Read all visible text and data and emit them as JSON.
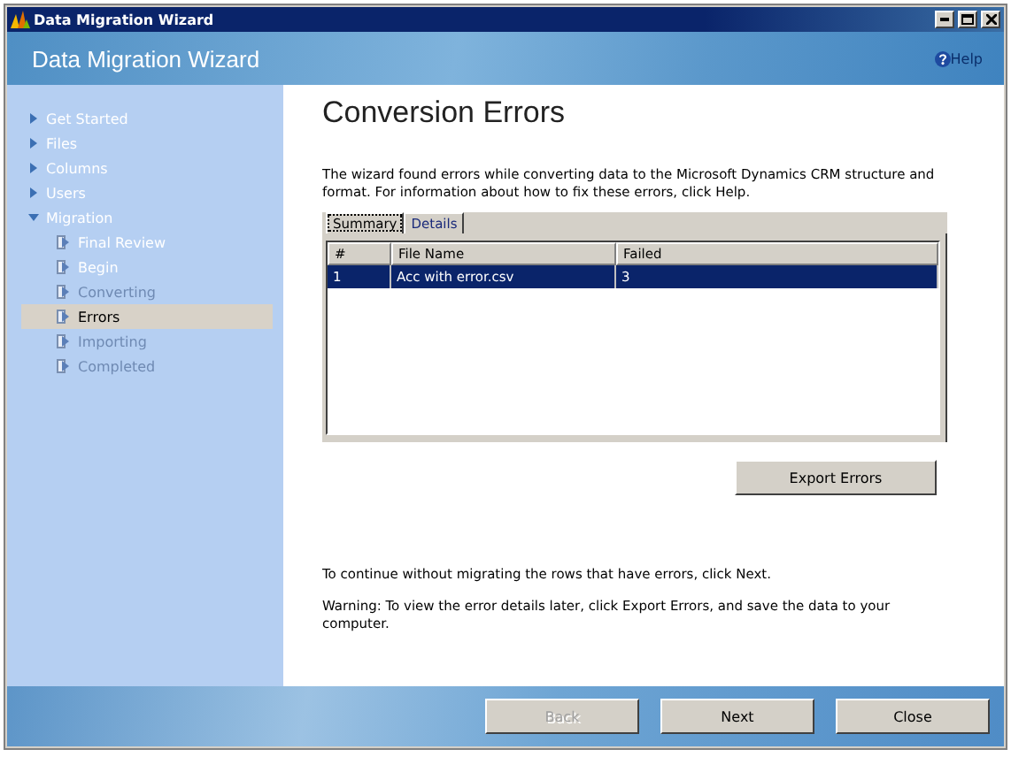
{
  "window": {
    "title": "Data Migration Wizard"
  },
  "header": {
    "title": "Data Migration Wizard",
    "help": "Help"
  },
  "sidebar": {
    "items": [
      {
        "label": "Get Started",
        "expanded": false,
        "selected": false,
        "disabled": false
      },
      {
        "label": "Files",
        "expanded": false,
        "selected": false,
        "disabled": false
      },
      {
        "label": "Columns",
        "expanded": false,
        "selected": false,
        "disabled": false
      },
      {
        "label": "Users",
        "expanded": false,
        "selected": false,
        "disabled": false
      },
      {
        "label": "Migration",
        "expanded": true,
        "selected": false,
        "disabled": false,
        "children": [
          {
            "label": "Final Review",
            "selected": false,
            "disabled": false
          },
          {
            "label": "Begin",
            "selected": false,
            "disabled": false
          },
          {
            "label": "Converting",
            "selected": false,
            "disabled": true
          },
          {
            "label": "Errors",
            "selected": true,
            "disabled": false
          },
          {
            "label": "Importing",
            "selected": false,
            "disabled": true
          },
          {
            "label": "Completed",
            "selected": false,
            "disabled": true
          }
        ]
      }
    ]
  },
  "page": {
    "title": "Conversion Errors",
    "intro": "The wizard found errors while converting data to the Microsoft Dynamics CRM structure and format. For information about how to fix these errors, click Help.",
    "tabs": [
      {
        "label": "Summary",
        "selected": true
      },
      {
        "label": "Details",
        "selected": false
      }
    ],
    "table": {
      "columns": [
        "#",
        "File Name",
        "Failed"
      ],
      "rows": [
        {
          "cells": [
            "1",
            "Acc with error.csv",
            "3"
          ],
          "selected": true
        }
      ]
    },
    "export_button": "Export Errors",
    "notes": [
      "To continue without migrating the rows that have errors, click Next.",
      "Warning: To view the error details later, click Export Errors, and save the data to your computer."
    ]
  },
  "buttons": [
    {
      "label": "Back",
      "disabled": true
    },
    {
      "label": "Next",
      "disabled": false
    },
    {
      "label": "Close",
      "disabled": false
    }
  ]
}
